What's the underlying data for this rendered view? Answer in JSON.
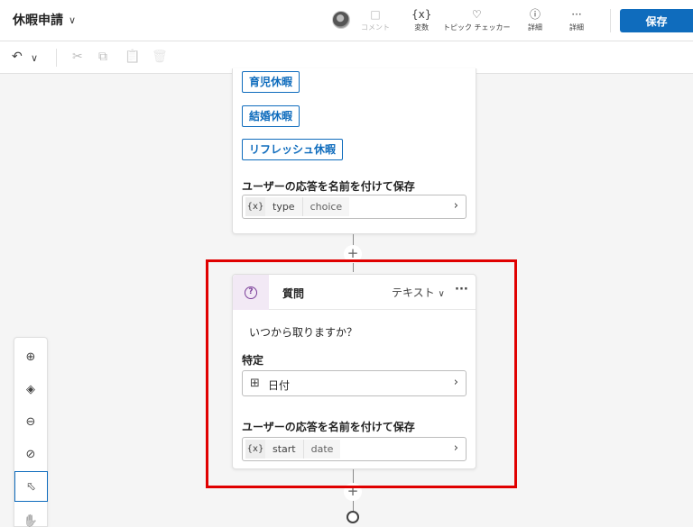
{
  "header": {
    "title": "休暇申請",
    "buttons": {
      "comment": {
        "label": "コメント",
        "icon": "□"
      },
      "variables": {
        "label": "変数",
        "icon": "{x}"
      },
      "topic_checker": {
        "label": "トピック チェッカー",
        "icon": "♡"
      },
      "details_info": {
        "label": "詳細",
        "icon": "ⓘ"
      },
      "details_more": {
        "label": "詳細",
        "icon": "···"
      }
    },
    "save_label": "保存"
  },
  "toolbar": {
    "undo_icon": "↶",
    "chevron": "∨",
    "cut_icon": "✂",
    "copy_icon": "⧉",
    "paste_icon": "📋",
    "delete_icon": "🗑"
  },
  "choice_node": {
    "options": [
      "育児休暇",
      "結婚休暇",
      "リフレッシュ休暇"
    ],
    "save_response_label": "ユーザーの応答を名前を付けて保存",
    "variable": {
      "icon": "{x}",
      "name": "type",
      "type": "choice"
    }
  },
  "question_node": {
    "title": "質問",
    "response_type": "テキスト",
    "more": "···",
    "question_text": "いつから取りますか？",
    "identify_label": "特定",
    "entity": "日付",
    "save_response_label": "ユーザーの応答を名前を付けて保存",
    "variable": {
      "icon": "{x}",
      "name": "start",
      "type": "date"
    }
  },
  "canvas_controls": {
    "zoom_in": "⊕",
    "fit": "◈",
    "zoom_out": "⊖",
    "minimap": "⊘",
    "select": "⬁",
    "pan": "✋"
  },
  "add_icon": "+",
  "colors": {
    "accent": "#0f6cbd",
    "highlight": "#e00000",
    "question_icon": "#7b3f99"
  }
}
